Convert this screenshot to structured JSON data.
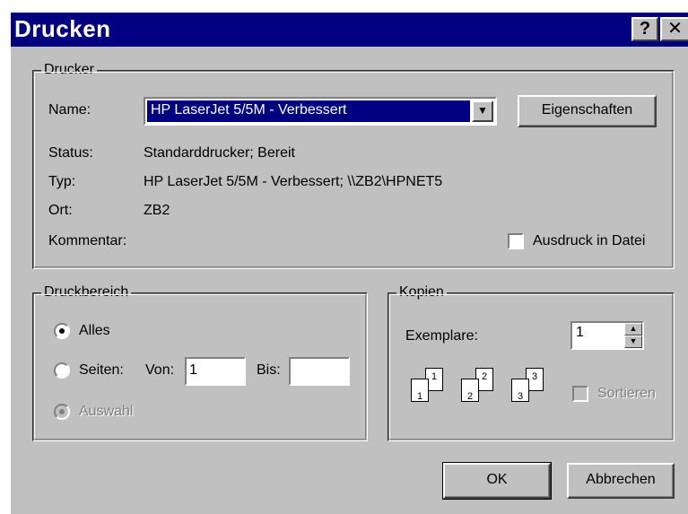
{
  "window": {
    "title": "Drucken",
    "help_label": "?",
    "close_label": "✕"
  },
  "printer": {
    "group_label": "Drucker",
    "name_label": "Name:",
    "name_value": "HP LaserJet 5/5M - Verbessert",
    "properties_button": "Eigenschaften",
    "status_label": "Status:",
    "status_value": "Standarddrucker; Bereit",
    "type_label": "Typ:",
    "type_value": "HP LaserJet 5/5M - Verbessert; \\\\ZB2\\HPNET5",
    "location_label": "Ort:",
    "location_value": "ZB2",
    "comment_label": "Kommentar:",
    "print_to_file_label": "Ausdruck in Datei",
    "print_to_file_checked": false
  },
  "range": {
    "group_label": "Druckbereich",
    "all_label": "Alles",
    "pages_label": "Seiten:",
    "from_label": "Von:",
    "from_value": "1",
    "to_label": "Bis:",
    "to_value": "",
    "selection_label": "Auswahl",
    "selected": "all"
  },
  "copies": {
    "group_label": "Kopien",
    "count_label": "Exemplare:",
    "count_value": "1",
    "collate_label": "Sortieren",
    "collate_enabled": false,
    "page_numbers": [
      "1",
      "1",
      "2",
      "2",
      "3",
      "3"
    ]
  },
  "buttons": {
    "ok": "OK",
    "cancel": "Abbrechen"
  },
  "icons": {
    "dropdown": "chevron-down-icon",
    "spin_up": "arrow-up-icon",
    "spin_down": "arrow-down-icon"
  }
}
